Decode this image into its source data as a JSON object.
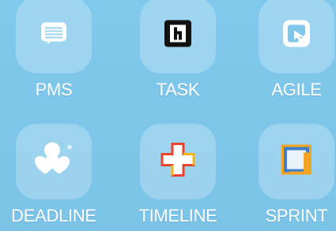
{
  "apps": [
    {
      "label": "PMS",
      "icon": "notes-icon"
    },
    {
      "label": "TASK",
      "icon": "task-icon"
    },
    {
      "label": "AGILE",
      "icon": "agile-icon"
    },
    {
      "label": "DEADLINE",
      "icon": "deadline-icon"
    },
    {
      "label": "TIMELINE",
      "icon": "timeline-icon"
    },
    {
      "label": "SPRINT",
      "icon": "sprint-icon"
    }
  ],
  "colors": {
    "background": "#7ec6ea",
    "tile": "rgba(255,255,255,0.24)",
    "label": "#ffffff",
    "task_icon_bg": "#111111",
    "timeline_cross_fill": "#ffffff",
    "timeline_cross_outline": "#e8452c",
    "timeline_cross_accent": "#f5b51c",
    "sprint_outer": "#f2a524",
    "sprint_inner": "#3f7fd0"
  }
}
